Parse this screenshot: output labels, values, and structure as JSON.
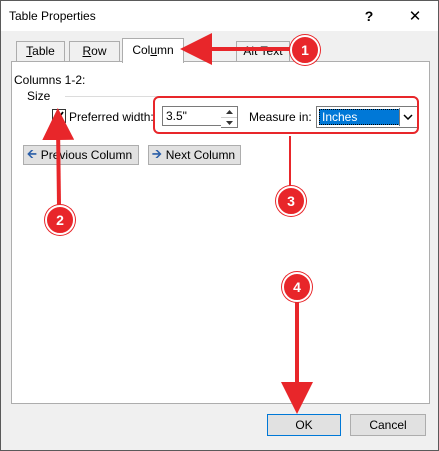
{
  "window": {
    "title": "Table Properties",
    "help_label": "?",
    "close_label": "✕"
  },
  "tabs": [
    {
      "label": "Table",
      "accel": "T",
      "rest": "able"
    },
    {
      "label": "Row",
      "accel": "R",
      "rest": "ow"
    },
    {
      "label": "Column",
      "pre": "Col",
      "accel": "u",
      "rest": "mn"
    },
    {
      "label": "Alt Text",
      "visible_fragment": "Alt Text"
    }
  ],
  "column_panel": {
    "section": "Columns 1-2:",
    "group": "Size",
    "preferred_width_label": "Preferred width:",
    "preferred_width_checked": true,
    "width_value": "3.5\"",
    "measure_in_label": "Measure in:",
    "measure_in_value": "Inches",
    "prev_button": "Previous Column",
    "next_button": "Next Column"
  },
  "footer": {
    "ok": "OK",
    "cancel": "Cancel"
  },
  "annotations": {
    "n1": "1",
    "n2": "2",
    "n3": "3",
    "n4": "4"
  },
  "colors": {
    "annotation": "#e8262a",
    "selection": "#0078d7"
  },
  "icons": {
    "close": "close-icon",
    "help": "help-icon",
    "check": "checkmark-icon",
    "spin_up": "caret-up-icon",
    "spin_down": "caret-down-icon",
    "dropdown": "chevron-down-icon",
    "prev": "arrow-left-icon",
    "next": "arrow-right-icon"
  }
}
